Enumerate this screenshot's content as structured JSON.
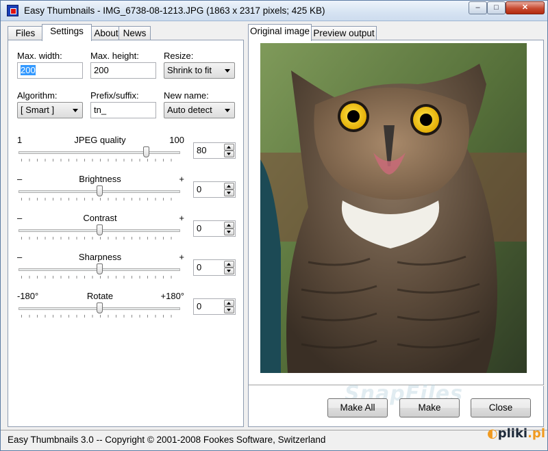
{
  "window": {
    "title": "Easy Thumbnails - IMG_6738-08-1213.JPG  (1863 x 2317 pixels;  425 KB)",
    "controls": {
      "minimize": "–",
      "maximize": "□",
      "close": "✕"
    }
  },
  "left_tabs": [
    {
      "label": "Files"
    },
    {
      "label": "Settings",
      "active": true
    },
    {
      "label": "About"
    },
    {
      "label": "News"
    }
  ],
  "settings": {
    "max_width_label": "Max. width:",
    "max_width_value": "200",
    "max_height_label": "Max. height:",
    "max_height_value": "200",
    "resize_label": "Resize:",
    "resize_value": "Shrink to fit",
    "algorithm_label": "Algorithm:",
    "algorithm_value": "[ Smart ]",
    "prefix_label": "Prefix/suffix:",
    "prefix_value": "tn_",
    "newname_label": "New name:",
    "newname_value": "Auto detect"
  },
  "sliders": [
    {
      "id": "jpeg",
      "min_label": "1",
      "label": "JPEG quality",
      "max_label": "100",
      "value": "80",
      "position": 0.8
    },
    {
      "id": "brightness",
      "min_label": "–",
      "label": "Brightness",
      "max_label": "+",
      "value": "0",
      "position": 0.5
    },
    {
      "id": "contrast",
      "min_label": "–",
      "label": "Contrast",
      "max_label": "+",
      "value": "0",
      "position": 0.5
    },
    {
      "id": "sharpness",
      "min_label": "–",
      "label": "Sharpness",
      "max_label": "+",
      "value": "0",
      "position": 0.5
    },
    {
      "id": "rotate",
      "min_label": "-180°",
      "label": "Rotate",
      "max_label": "+180°",
      "value": "0",
      "position": 0.5
    }
  ],
  "right_tabs": [
    {
      "label": "Original image",
      "active": true
    },
    {
      "label": "Preview output"
    }
  ],
  "buttons": {
    "make_all": "Make All",
    "make": "Make",
    "close": "Close"
  },
  "status": "Easy Thumbnails 3.0 -- Copyright © 2001-2008 Fookes Software, Switzerland",
  "watermark": "SnapFiles",
  "corner_logo": {
    "text": "pliki",
    "suffix": ".pl"
  },
  "icons": {
    "app": "app-icon",
    "spin": "spin-updown-icon",
    "combo": "chevron-down-icon"
  }
}
